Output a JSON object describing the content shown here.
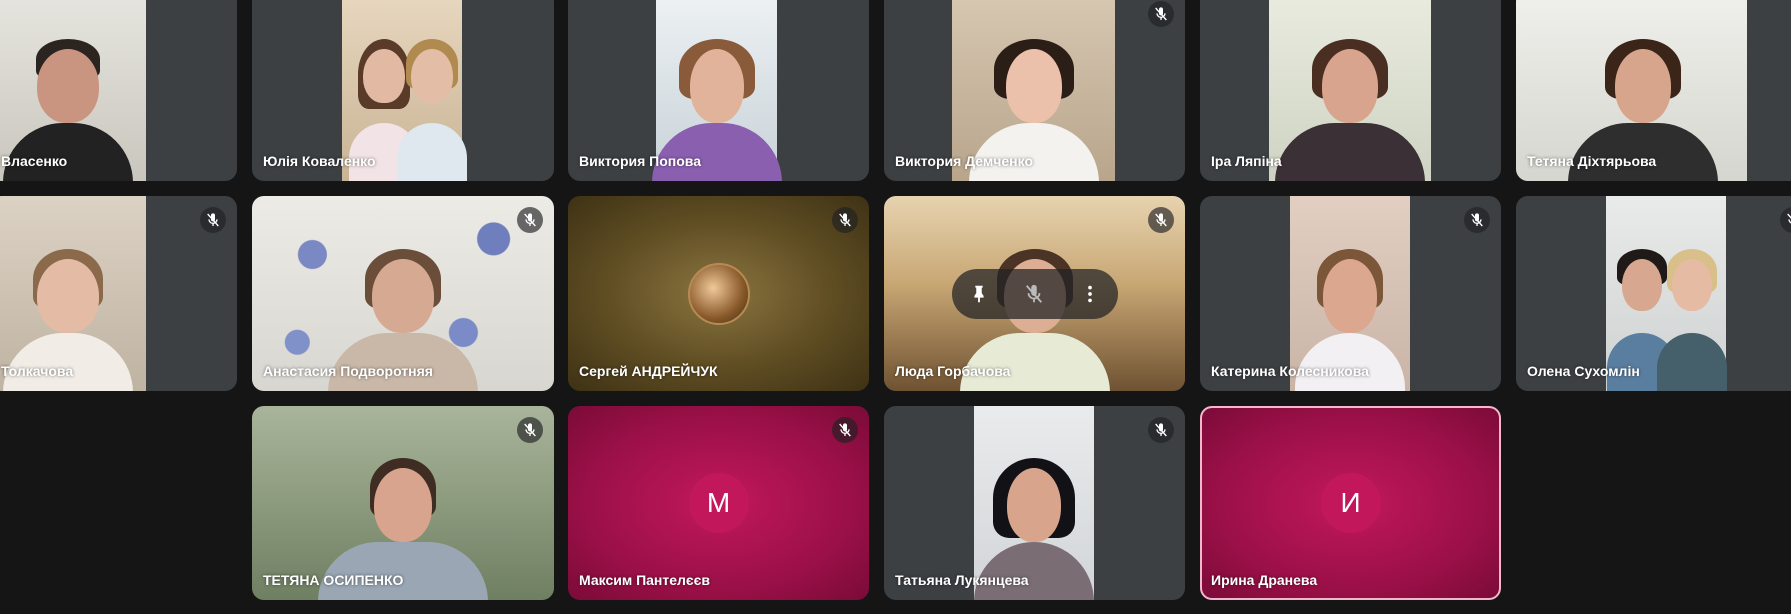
{
  "meeting": {
    "tiles": [
      {
        "name": "Власенко"
      },
      {
        "name": "Юлія Коваленко"
      },
      {
        "name": "Виктория Попова"
      },
      {
        "name": "Виктория Демченко"
      },
      {
        "name": "Іра Ляпіна"
      },
      {
        "name": "Тетяна Діхтярьова"
      },
      {
        "name": "Толкачова"
      },
      {
        "name": "Анастасия Подворотняя"
      },
      {
        "name": "Сергей АНДРЕЙЧУК"
      },
      {
        "name": "Люда Горбачова"
      },
      {
        "name": "Катерина Колесникова"
      },
      {
        "name": "Олена Сухомлін"
      },
      {
        "name": "ТЕТЯНА ОСИПЕНКО"
      },
      {
        "name": "Максим Пантелєєв",
        "initial": "М"
      },
      {
        "name": "Татьяна Лукянцева"
      },
      {
        "name": "Ирина Дранева",
        "initial": "И"
      }
    ],
    "icons": {
      "muted": "mic-off-icon",
      "pin": "pin-icon",
      "more": "more-vert-icon"
    },
    "colors": {
      "background": "#151515",
      "tile": "#3c4043",
      "avatar_tile": "#a01450",
      "avatar_circle": "#c2185b",
      "speaking_border": "#f4b6cd"
    }
  }
}
